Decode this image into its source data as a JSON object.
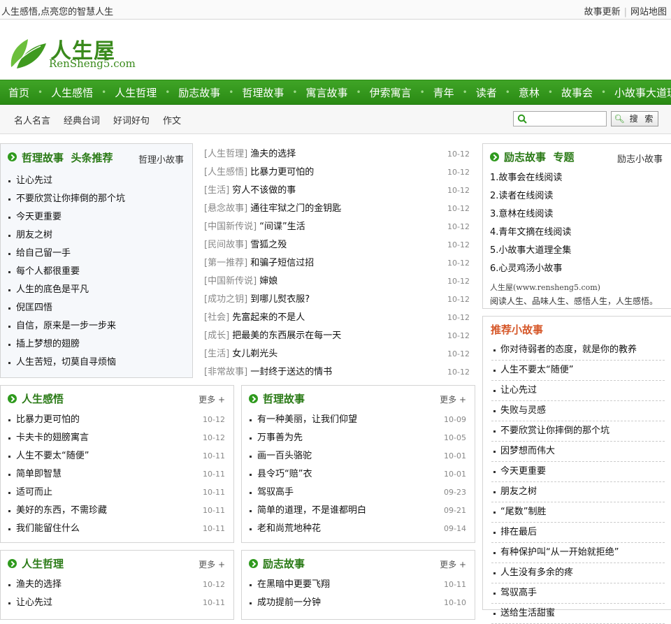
{
  "top": {
    "slogan": "人生感悟,点亮您的智慧人生",
    "links": [
      "故事更新",
      "网站地图"
    ]
  },
  "logo": {
    "cn": "人生屋",
    "en": "RenSheng5.com"
  },
  "nav": [
    "首页",
    "人生感悟",
    "人生哲理",
    "励志故事",
    "哲理故事",
    "寓言故事",
    "伊索寓言",
    "青年",
    "读者",
    "意林",
    "故事会",
    "小故事大道理"
  ],
  "subnav": [
    "名人名言",
    "经典台词",
    "好词好句",
    "作文"
  ],
  "search": {
    "button": "搜 索"
  },
  "panel_head": {
    "title": "哲理故事  头条推荐",
    "more": "哲理小故事",
    "items": [
      "让心先过",
      "不要欣赏让你摔倒的那个坑",
      "今天更重要",
      "朋友之树",
      "给自己留一手",
      "每个人都很重要",
      "人生的底色是平凡",
      "倪匡四悟",
      "自信，原来是一步一步来",
      "插上梦想的翅膀",
      "人生苦短，切莫自寻烦恼"
    ]
  },
  "mid_list": [
    {
      "cat": "[人生哲理]",
      "title": "渔夫的选择",
      "date": "10-12"
    },
    {
      "cat": "[人生感悟]",
      "title": "比暴力更可怕的",
      "date": "10-12"
    },
    {
      "cat": "[生活]",
      "title": "穷人不该做的事",
      "date": "10-12"
    },
    {
      "cat": "[悬念故事]",
      "title": "通往牢狱之门的金钥匙",
      "date": "10-12"
    },
    {
      "cat": "[中国新传说]",
      "title": "“间谍”生活",
      "date": "10-12"
    },
    {
      "cat": "[民间故事]",
      "title": "雪狐之殁",
      "date": "10-12"
    },
    {
      "cat": "[第一推荐]",
      "title": "和骗子短信过招",
      "date": "10-12"
    },
    {
      "cat": "[中国新传说]",
      "title": "婶娘",
      "date": "10-12"
    },
    {
      "cat": "[成功之钥]",
      "title": "到哪儿熨衣服?",
      "date": "10-12"
    },
    {
      "cat": "[社会]",
      "title": "先富起来的不是人",
      "date": "10-12"
    },
    {
      "cat": "[成长]",
      "title": "把最美的东西展示在每一天",
      "date": "10-12"
    },
    {
      "cat": "[生活]",
      "title": "女儿剃光头",
      "date": "10-12"
    },
    {
      "cat": "[非常故事]",
      "title": "一封终于送达的情书",
      "date": "10-12"
    }
  ],
  "panel_topic": {
    "title": "励志故事  专题",
    "more": "励志小故事",
    "items": [
      "1.故事会在线阅读",
      "2.读者在线阅读",
      "3.意林在线阅读",
      "4.青年文摘在线阅读",
      "5.小故事大道理全集",
      "6.心灵鸡汤小故事"
    ],
    "site": "人生屋(www.rensheng5.com)",
    "desc": "阅读人生、品味人生、感悟人生，人生感悟。"
  },
  "panel_ganwu": {
    "title": "人生感悟",
    "more": "更多 +",
    "items": [
      {
        "title": "比暴力更可怕的",
        "date": "10-12"
      },
      {
        "title": "卡夫卡的翅膀寓言",
        "date": "10-12"
      },
      {
        "title": "人生不要太“随便”",
        "date": "10-11"
      },
      {
        "title": "简单即智慧",
        "date": "10-11"
      },
      {
        "title": "适可而止",
        "date": "10-11"
      },
      {
        "title": "美好的东西，不需珍藏",
        "date": "10-11"
      },
      {
        "title": "我们能留住什么",
        "date": "10-11"
      }
    ]
  },
  "panel_zheli": {
    "title": "哲理故事",
    "more": "更多 +",
    "items": [
      {
        "title": "有一种美丽，让我们仰望",
        "date": "10-09"
      },
      {
        "title": "万事善为先",
        "date": "10-05"
      },
      {
        "title": "画一百头骆驼",
        "date": "10-01"
      },
      {
        "title": "县令巧“赔”衣",
        "date": "10-01"
      },
      {
        "title": "驾驭高手",
        "date": "09-23"
      },
      {
        "title": "简单的道理，不是谁都明白",
        "date": "09-21"
      },
      {
        "title": "老和尚荒地种花",
        "date": "09-14"
      }
    ]
  },
  "panel_rsz": {
    "title": "人生哲理",
    "more": "更多 +",
    "items": [
      {
        "title": "渔夫的选择",
        "date": "10-12"
      },
      {
        "title": "让心先过",
        "date": "10-11"
      }
    ]
  },
  "panel_lizhi": {
    "title": "励志故事",
    "more": "更多 +",
    "items": [
      {
        "title": "在黑暗中更要飞翔",
        "date": "10-11"
      },
      {
        "title": "成功提前一分钟",
        "date": "10-10"
      }
    ]
  },
  "recommend": {
    "title": "推荐小故事",
    "items": [
      "你对待弱者的态度，就是你的教养",
      "人生不要太“随便”",
      "让心先过",
      "失败与灵感",
      "不要欣赏让你摔倒的那个坑",
      "因梦想而伟大",
      "今天更重要",
      "朋友之树",
      "“尾数”制胜",
      "排在最后",
      "有种保护叫“从一开始就拒绝”",
      "人生没有多余的疼",
      "驾驭高手",
      "送给生活甜蜜"
    ]
  },
  "colors": {
    "brand_green": "#2f9a1e",
    "recommend_title": "#d6582a"
  }
}
